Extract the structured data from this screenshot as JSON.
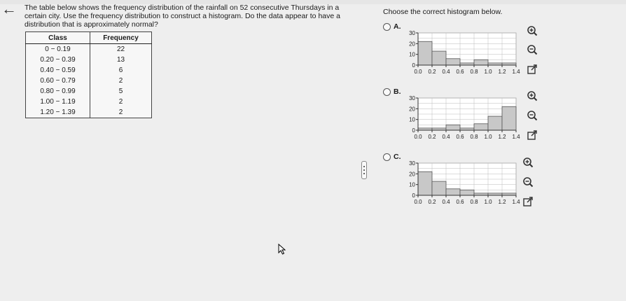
{
  "question": {
    "text": "The table below shows the frequency distribution of the rainfall on 52 consecutive Thursdays in a certain city. Use the frequency distribution to construct a histogram. Do the data appear to have a distribution that is approximately normal?"
  },
  "prompt": "Choose the correct histogram below.",
  "table": {
    "headers": [
      "Class",
      "Frequency"
    ],
    "rows": [
      {
        "cls": "0 − 0.19",
        "freq": "22"
      },
      {
        "cls": "0.20 − 0.39",
        "freq": "13"
      },
      {
        "cls": "0.40 − 0.59",
        "freq": "6"
      },
      {
        "cls": "0.60 − 0.79",
        "freq": "2"
      },
      {
        "cls": "0.80 − 0.99",
        "freq": "5"
      },
      {
        "cls": "1.00 − 1.19",
        "freq": "2"
      },
      {
        "cls": "1.20 − 1.39",
        "freq": "2"
      }
    ]
  },
  "options": [
    {
      "label": "A.",
      "zoom_in": "zoom-in-icon",
      "zoom_out": "zoom-out-icon",
      "expand": "expand-icon"
    },
    {
      "label": "B.",
      "zoom_in": "zoom-in-icon",
      "zoom_out": "zoom-out-icon",
      "expand": "expand-icon"
    },
    {
      "label": "C.",
      "zoom_in": "zoom-in-icon",
      "zoom_out": "zoom-out-icon",
      "expand": "expand-icon"
    }
  ],
  "colors": {
    "bar": "#c8c8c8",
    "grid": "#999999",
    "axis": "#333333"
  },
  "chart_data": [
    {
      "type": "bar",
      "x": [
        0.1,
        0.3,
        0.5,
        0.7,
        0.9,
        1.1,
        1.3
      ],
      "values": [
        22,
        13,
        6,
        2,
        5,
        2,
        2
      ],
      "bin_width": 0.2,
      "xticks": [
        "0.0",
        "0.2",
        "0.4",
        "0.6",
        "0.8",
        "1.0",
        "1.2",
        "1.4"
      ],
      "yticks": [
        "0",
        "10",
        "20",
        "30"
      ],
      "xlim": [
        0,
        1.4
      ],
      "ylim": [
        0,
        30
      ],
      "grid": true
    },
    {
      "type": "bar",
      "x": [
        0.1,
        0.3,
        0.5,
        0.7,
        0.9,
        1.1,
        1.3
      ],
      "values": [
        2,
        2,
        5,
        2,
        6,
        13,
        22
      ],
      "bin_width": 0.2,
      "xticks": [
        "0.0",
        "0.2",
        "0.4",
        "0.6",
        "0.8",
        "1.0",
        "1.2",
        "1.4"
      ],
      "yticks": [
        "0",
        "10",
        "20",
        "30"
      ],
      "xlim": [
        0,
        1.4
      ],
      "ylim": [
        0,
        30
      ],
      "grid": true
    },
    {
      "type": "bar",
      "x": [
        0.1,
        0.3,
        0.5,
        0.7,
        0.9,
        1.1,
        1.3
      ],
      "values": [
        22,
        13,
        6,
        5,
        2,
        2,
        2
      ],
      "bin_width": 0.2,
      "xticks": [
        "0.0",
        "0.2",
        "0.4",
        "0.6",
        "0.8",
        "1.0",
        "1.2",
        "1.4"
      ],
      "yticks": [
        "0",
        "10",
        "20",
        "30"
      ],
      "xlim": [
        0,
        1.4
      ],
      "ylim": [
        0,
        30
      ],
      "grid": true
    }
  ]
}
